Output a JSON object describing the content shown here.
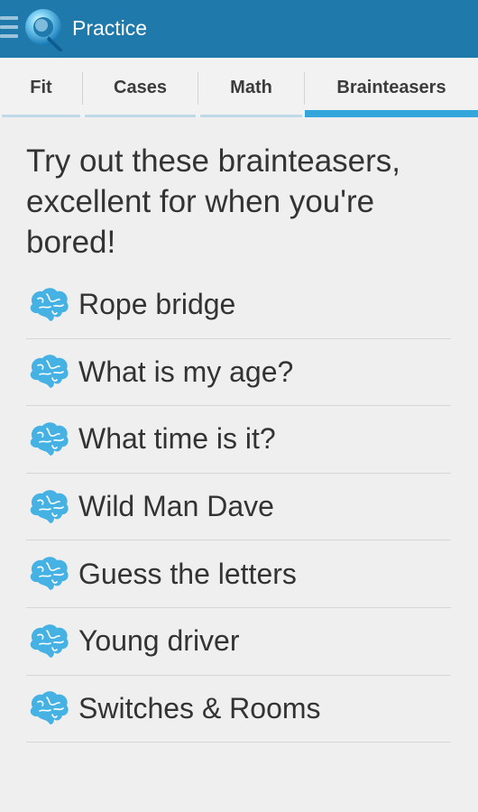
{
  "app_bar": {
    "title": "Practice",
    "colors": {
      "background": "#1f79ab",
      "accent": "#33a7dc"
    }
  },
  "tabs": [
    {
      "label": "Fit",
      "active": false
    },
    {
      "label": "Cases",
      "active": false
    },
    {
      "label": "Math",
      "active": false
    },
    {
      "label": "Brainteasers",
      "active": true
    }
  ],
  "intro": "Try out these brainteasers, excellent for when you're bored!",
  "items": [
    {
      "icon": "brain-icon",
      "label": "Rope bridge"
    },
    {
      "icon": "brain-icon",
      "label": "What is my age?"
    },
    {
      "icon": "brain-icon",
      "label": "What time is it?"
    },
    {
      "icon": "brain-icon",
      "label": "Wild Man Dave"
    },
    {
      "icon": "brain-icon",
      "label": "Guess the letters"
    },
    {
      "icon": "brain-icon",
      "label": "Young driver"
    },
    {
      "icon": "brain-icon",
      "label": "Switches & Rooms"
    }
  ]
}
